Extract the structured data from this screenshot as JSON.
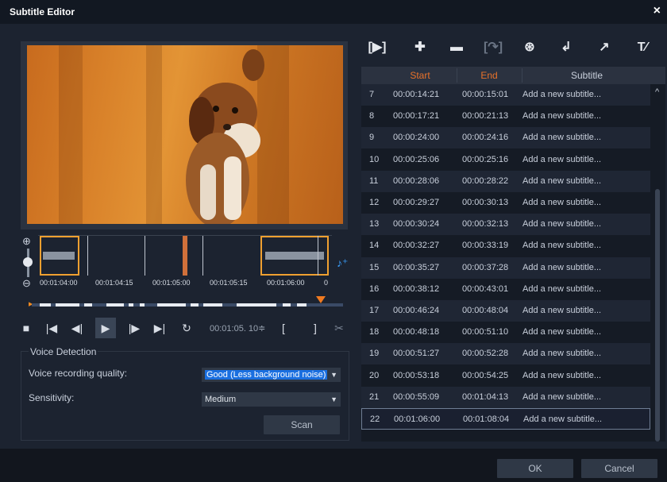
{
  "window": {
    "title": "Subtitle Editor",
    "close_glyph": "×"
  },
  "timeline": {
    "ticks": [
      "00:01:04:00",
      "00:01:04:15",
      "00:01:05:00",
      "00:01:05:15",
      "00:01:06:00",
      "0"
    ],
    "zoom_in_glyph": "⊕",
    "zoom_out_glyph": "⊖",
    "voice_wave_glyph": "♪⁺"
  },
  "transport": {
    "stop": "■",
    "go_start": "|◀",
    "prev_frame": "◀|",
    "play": "▶",
    "next_frame": "|▶",
    "go_end": "▶|",
    "repeat": "↻",
    "timecode": "00:01:05. 10≑",
    "mark_in": "[",
    "mark_out": "]",
    "split": "✂"
  },
  "voice_detection": {
    "title": "Voice Detection",
    "quality_label": "Voice recording quality:",
    "quality_value": "Good (Less background noise)",
    "sensitivity_label": "Sensitivity:",
    "sensitivity_value": "Medium",
    "scan_label": "Scan"
  },
  "toolbar": {
    "play_subtitle": "[▶]",
    "add": "✚",
    "remove": "▬",
    "merge": "[↷]",
    "voice_detect": "⊛",
    "import": "↲",
    "export": "↗",
    "text_options": "T⁄"
  },
  "table": {
    "headers": {
      "start": "Start",
      "end": "End",
      "subtitle": "Subtitle"
    },
    "header_accent": "#e8722a",
    "rows": [
      {
        "num": "7",
        "start": "00:00:14:21",
        "end": "00:00:15:01",
        "subtitle": "Add a new subtitle..."
      },
      {
        "num": "8",
        "start": "00:00:17:21",
        "end": "00:00:21:13",
        "subtitle": "Add a new subtitle..."
      },
      {
        "num": "9",
        "start": "00:00:24:00",
        "end": "00:00:24:16",
        "subtitle": "Add a new subtitle..."
      },
      {
        "num": "10",
        "start": "00:00:25:06",
        "end": "00:00:25:16",
        "subtitle": "Add a new subtitle..."
      },
      {
        "num": "11",
        "start": "00:00:28:06",
        "end": "00:00:28:22",
        "subtitle": "Add a new subtitle..."
      },
      {
        "num": "12",
        "start": "00:00:29:27",
        "end": "00:00:30:13",
        "subtitle": "Add a new subtitle..."
      },
      {
        "num": "13",
        "start": "00:00:30:24",
        "end": "00:00:32:13",
        "subtitle": "Add a new subtitle..."
      },
      {
        "num": "14",
        "start": "00:00:32:27",
        "end": "00:00:33:19",
        "subtitle": "Add a new subtitle..."
      },
      {
        "num": "15",
        "start": "00:00:35:27",
        "end": "00:00:37:28",
        "subtitle": "Add a new subtitle..."
      },
      {
        "num": "16",
        "start": "00:00:38:12",
        "end": "00:00:43:01",
        "subtitle": "Add a new subtitle..."
      },
      {
        "num": "17",
        "start": "00:00:46:24",
        "end": "00:00:48:04",
        "subtitle": "Add a new subtitle..."
      },
      {
        "num": "18",
        "start": "00:00:48:18",
        "end": "00:00:51:10",
        "subtitle": "Add a new subtitle..."
      },
      {
        "num": "19",
        "start": "00:00:51:27",
        "end": "00:00:52:28",
        "subtitle": "Add a new subtitle..."
      },
      {
        "num": "20",
        "start": "00:00:53:18",
        "end": "00:00:54:25",
        "subtitle": "Add a new subtitle..."
      },
      {
        "num": "21",
        "start": "00:00:55:09",
        "end": "00:01:04:13",
        "subtitle": "Add a new subtitle..."
      },
      {
        "num": "22",
        "start": "00:01:06:00",
        "end": "00:01:08:04",
        "subtitle": "Add a new subtitle..."
      }
    ],
    "scroll_up_glyph": "^"
  },
  "footer": {
    "ok_label": "OK",
    "cancel_label": "Cancel"
  }
}
